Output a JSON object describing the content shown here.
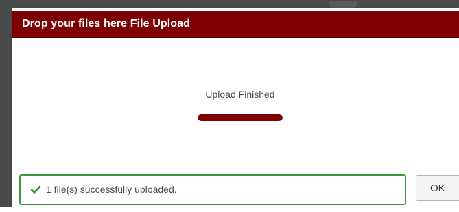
{
  "dialog": {
    "title": "Drop your files here File Upload",
    "status_text": "Upload Finished",
    "progress": 1.0,
    "success_message": "1 file(s) successfully uploaded.",
    "ok_label": "OK"
  },
  "colors": {
    "accent": "#7f0000",
    "success_border": "#3c9a3c",
    "check": "#2e8b2e"
  },
  "icons": {
    "success": "check-icon"
  }
}
